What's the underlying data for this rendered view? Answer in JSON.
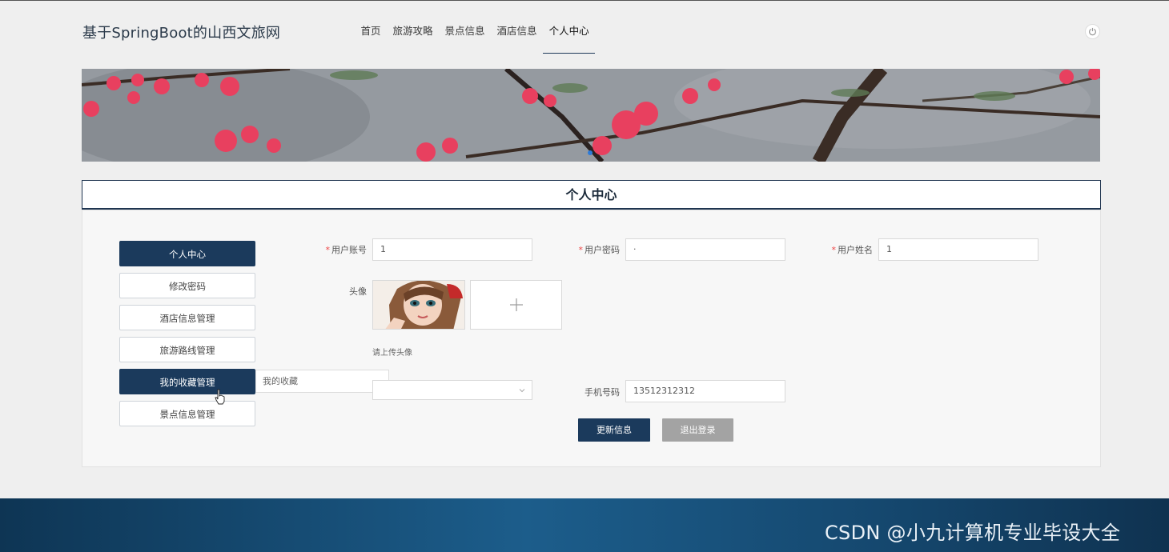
{
  "site": {
    "title": "基于SpringBoot的山西文旅网"
  },
  "nav": {
    "items": [
      {
        "label": "首页"
      },
      {
        "label": "旅游攻略"
      },
      {
        "label": "景点信息"
      },
      {
        "label": "酒店信息"
      },
      {
        "label": "个人中心"
      }
    ],
    "active_index": 4
  },
  "section": {
    "title": "个人中心"
  },
  "side_menu": {
    "items": [
      {
        "label": "个人中心"
      },
      {
        "label": "修改密码"
      },
      {
        "label": "酒店信息管理"
      },
      {
        "label": "旅游路线管理"
      },
      {
        "label": "我的收藏管理"
      },
      {
        "label": "景点信息管理"
      }
    ],
    "dropdown_item": "我的收藏"
  },
  "form": {
    "account_label": "用户账号",
    "account_value": "1",
    "password_label": "用户密码",
    "password_value": "·",
    "name_label": "用户姓名",
    "name_value": "1",
    "avatar_label": "头像",
    "avatar_hint": "请上传头像",
    "phone_label": "手机号码",
    "phone_value": "13512312312"
  },
  "buttons": {
    "update": "更新信息",
    "logout": "退出登录"
  },
  "watermark": "CSDN @小九计算机专业毕设大全",
  "colors": {
    "primary": "#1b3a5c",
    "secondary_button": "#a3a3a3",
    "required_mark": "#ee4444",
    "footer": "#1c5d8b"
  },
  "icons": {
    "power": "power-icon",
    "plus": "plus-icon",
    "chevron": "chevron-down-icon",
    "cursor": "hand-cursor-icon"
  }
}
